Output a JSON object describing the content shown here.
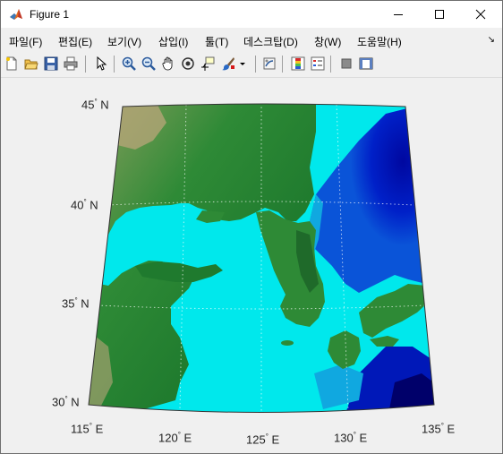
{
  "window": {
    "title": "Figure 1",
    "controls": [
      "minimize",
      "maximize",
      "close"
    ]
  },
  "menu": {
    "items": [
      "파일(F)",
      "편집(E)",
      "보기(V)",
      "삽입(I)",
      "툴(T)",
      "데스크탑(D)",
      "창(W)",
      "도움말(H)"
    ],
    "overflow_arrow": "↘"
  },
  "toolbar": {
    "icons": [
      "new-figure-icon",
      "open-icon",
      "save-icon",
      "print-icon",
      "pointer-icon",
      "zoom-in-icon",
      "zoom-out-icon",
      "pan-icon",
      "rotate-3d-icon",
      "data-cursor-icon",
      "brush-icon",
      "brush-dropdown-icon",
      "link-plot-icon",
      "colorbar-icon",
      "legend-icon",
      "hide-plot-tools-icon",
      "show-plot-tools-icon"
    ]
  },
  "map": {
    "lat_labels": [
      {
        "deg": "45",
        "dir": "N"
      },
      {
        "deg": "40",
        "dir": "N"
      },
      {
        "deg": "35",
        "dir": "N"
      },
      {
        "deg": "30",
        "dir": "N"
      }
    ],
    "lon_labels": [
      {
        "deg": "115",
        "dir": "E"
      },
      {
        "deg": "120",
        "dir": "E"
      },
      {
        "deg": "125",
        "dir": "E"
      },
      {
        "deg": "130",
        "dir": "E"
      },
      {
        "deg": "135",
        "dir": "E"
      }
    ],
    "colors": {
      "land_green": "#1f7a2e",
      "land_dark_green": "#0f6a25",
      "highland_tan": "#b9a57a",
      "shallow_sea": "#00e8ec",
      "mid_sea": "#10a8e0",
      "deep_sea": "#0018b8",
      "deepest_sea": "#00006a"
    }
  }
}
